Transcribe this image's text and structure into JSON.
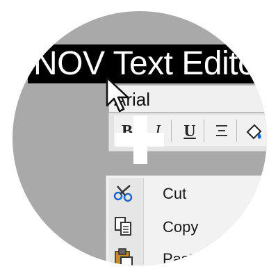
{
  "window": {
    "title": "NOV Text Editor"
  },
  "format_bar": {
    "font_name": "Arial",
    "bold_label": "B",
    "italic_label": "I",
    "underline_label": "U"
  },
  "context_menu": {
    "items": [
      {
        "label": "Cut",
        "icon": "scissors-icon"
      },
      {
        "label": "Copy",
        "icon": "copy-icon"
      },
      {
        "label": "Paste",
        "icon": "paste-icon"
      }
    ]
  },
  "colors": {
    "lens_background": "#a9a9a9",
    "title_bar": "#000000",
    "title_text": "#ffffff",
    "menu_background": "#f2f2f2"
  }
}
